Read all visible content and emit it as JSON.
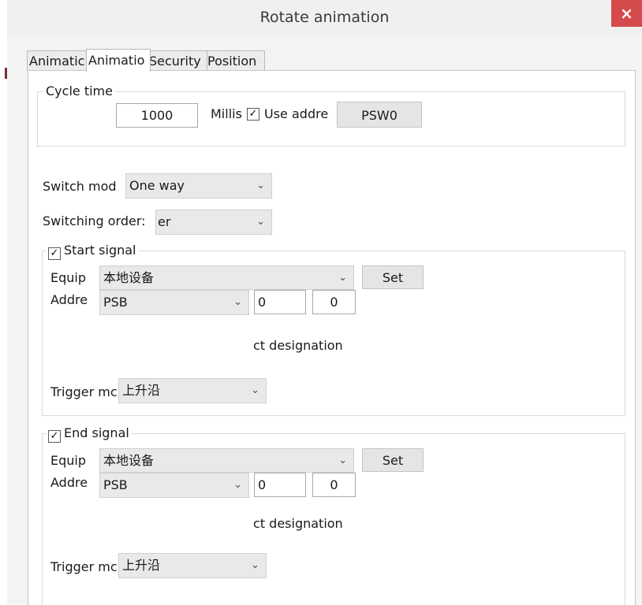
{
  "window": {
    "title": "Rotate animation",
    "close_glyph": "×"
  },
  "tabs": [
    {
      "label": "Animatic"
    },
    {
      "label": "Animatio"
    },
    {
      "label": "Security"
    },
    {
      "label": "Position"
    }
  ],
  "cycle": {
    "group_title": "Cycle time",
    "value": "1000",
    "unit_label": "Millis",
    "use_address_checked": true,
    "use_address_label": "Use addre",
    "address_button": "PSW0"
  },
  "switch_mode": {
    "label": "Switch mod",
    "value": "One way",
    "chevron": "⌄"
  },
  "switching_order": {
    "label": "Switching order:",
    "value": "er",
    "chevron": "⌄"
  },
  "start_signal": {
    "checked": true,
    "title": "Start signal",
    "equip_label": "Equip",
    "equip_value": "本地设备",
    "set_button": "Set",
    "addr_label": "Addre",
    "addr_type": "PSB",
    "addr_field1": "0",
    "addr_field2": "0",
    "designation": "ct designation",
    "trigger_label": "Trigger mc",
    "trigger_value": "上升沿"
  },
  "end_signal": {
    "checked": true,
    "title": "End signal",
    "equip_label": "Equip",
    "equip_value": "本地设备",
    "set_button": "Set",
    "addr_label": "Addre",
    "addr_type": "PSB",
    "addr_field1": "0",
    "addr_field2": "0",
    "designation": "ct designation",
    "trigger_label": "Trigger mc",
    "trigger_value": "上升沿"
  },
  "icons": {
    "check": "✓",
    "chevron": "⌄"
  },
  "colors": {
    "close_button": "#d54a4a",
    "panel_bg": "#ffffff",
    "frame_bg": "#f3f3f3"
  }
}
